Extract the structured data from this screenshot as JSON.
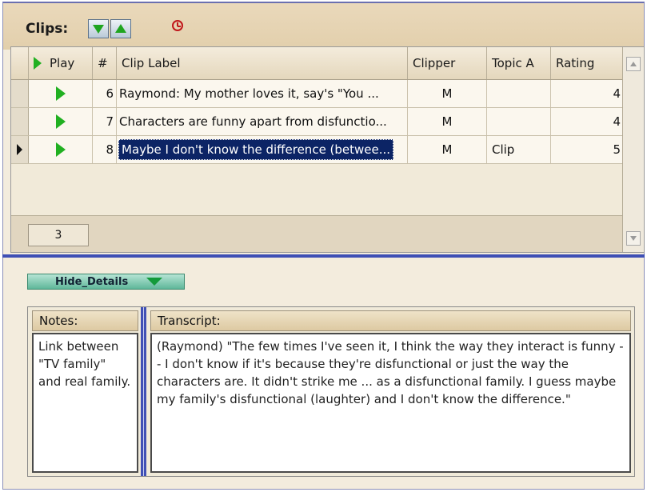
{
  "toolbar": {
    "clips_label": "Clips:",
    "down_icon": "green-down-arrow-icon",
    "up_icon": "green-up-arrow-icon",
    "clock_icon": "clock-icon"
  },
  "grid": {
    "headers": {
      "play": "Play",
      "num": "#",
      "label": "Clip Label",
      "clipper": "Clipper",
      "topic": "Topic A",
      "rating": "Rating"
    },
    "rows": [
      {
        "num": "6",
        "label": "Raymond:  My mother loves it, say's \"You ...",
        "clipper": "M",
        "topic": "",
        "rating": "4",
        "selected": false
      },
      {
        "num": "7",
        "label": "Characters are funny apart from disfunctio...",
        "clipper": "M",
        "topic": "",
        "rating": "4",
        "selected": false
      },
      {
        "num": "8",
        "label": "Maybe I don't know the difference (betwee...",
        "clipper": "M",
        "topic": "Clip",
        "rating": "5",
        "selected": true
      }
    ],
    "record_count": "3"
  },
  "details": {
    "hide_button_label": "Hide_Details",
    "notes_header": "Notes:",
    "notes_text": "Link between \"TV family\" and real family.",
    "transcript_header": "Transcript:",
    "transcript_text": "(Raymond) \"The few times I've seen it, I think the way they interact is funny -- I don't know if it's because they're disfunctional or just the way the characters are.  It didn't strike me ... as a disfunctional family.  I guess maybe my family's disfunctional (laughter) and I don't know the difference.\""
  },
  "colors": {
    "accent_blue": "#3e4fb5",
    "play_green": "#21b021",
    "selection": "#0c2465"
  }
}
